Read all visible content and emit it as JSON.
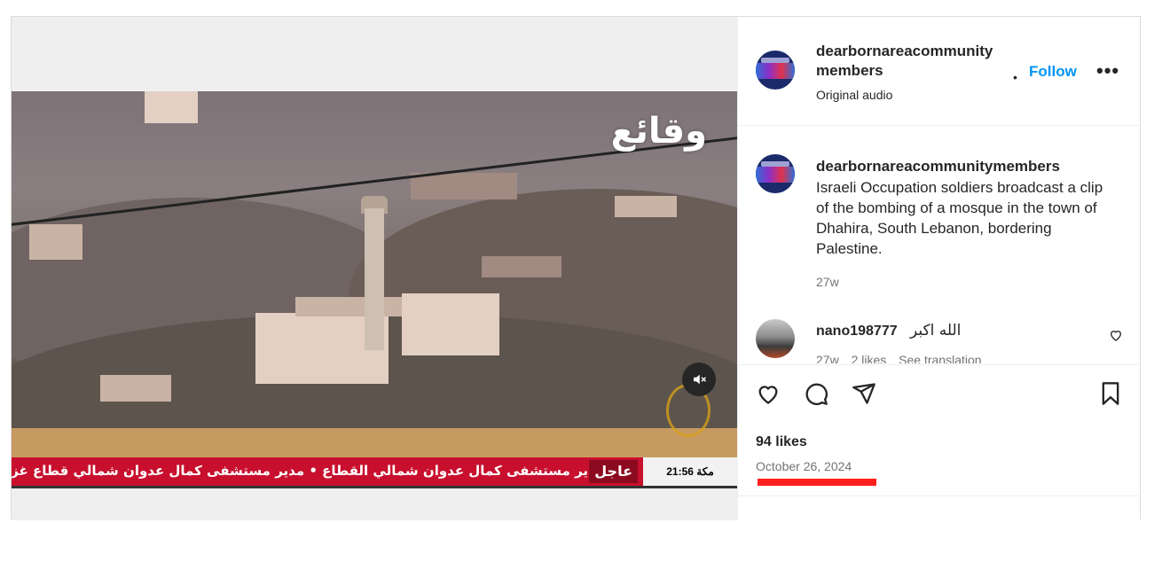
{
  "post": {
    "video": {
      "watermark": "وقائع",
      "ticker_breaking": "عاجل",
      "ticker_text": "مدير مستشفى كمال عدوان شمالي القطاع  •  مدير مستشفى كمال عدوان شمالي قطاع غزة: كنا نتوقع",
      "ticker_counter": "21:56 مكة",
      "mute_icon": "speaker-muted-icon"
    },
    "header": {
      "username": "dearbornareacommunity members",
      "subtitle": "Original audio",
      "separator": "•",
      "follow_label": "Follow",
      "more_label": "•••"
    },
    "caption": {
      "username": "dearbornareacommunitymembers",
      "text": "Israeli Occupation soldiers broadcast a clip of the bombing of a mosque in the town of Dhahira, South Lebanon, bordering Palestine.",
      "time": "27w"
    },
    "comment": {
      "username": "nano198777",
      "text": "الله اكبر",
      "time": "27w",
      "likes": "2 likes",
      "translate": "See translation"
    },
    "actions": {
      "likes": "94 likes",
      "date": "October 26, 2024"
    },
    "colors": {
      "follow": "#0095f6",
      "highlight": "#ff1f1f",
      "ticker": "#c8102e"
    }
  }
}
